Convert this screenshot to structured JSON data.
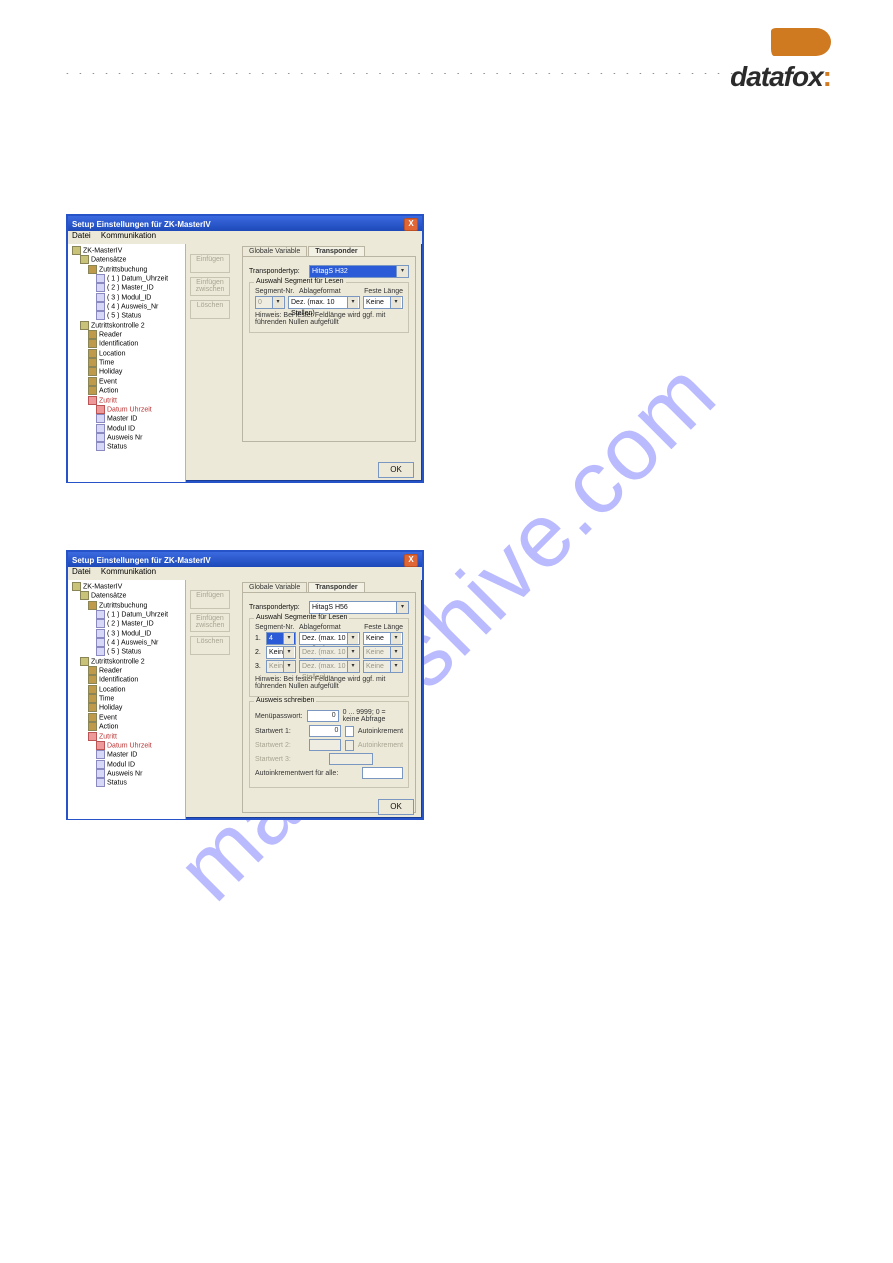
{
  "watermark_text": "manualshive.com",
  "logo_text": "datafox",
  "logo_colon": ":",
  "dots": "• • • • • • • • • • • • • • • • • • • • • • • • • • • • • • • • • • • • • • • • • • • • • • • • • • • • • • • • • • • • • • • • • • • • • • • • • • • • • • • • • • • • • • • • • • • • • • • •",
  "dialog_title": "Setup Einstellungen für ZK-MasterIV",
  "close_label": "X",
  "menu": {
    "datei": "Datei",
    "komm": "Kommunikation"
  },
  "buttons": {
    "einfuegen": "Einfügen",
    "einfuegen_zw": "Einfügen zwischen",
    "loeschen": "Löschen",
    "ok": "OK"
  },
  "tabs": {
    "globale": "Globale Variable",
    "transponder": "Transponder"
  },
  "labels": {
    "transpondertyp": "Transpondertyp:",
    "group_read": "Auswahl Segment für Lesen",
    "group_read_plural": "Auswahl Segmente für Lesen",
    "segment_nr": "Segment-Nr.",
    "ablageformat": "Ablageformat",
    "feste_laenge": "Feste Länge",
    "hint": "Hinweis: Bei fester Feldlänge wird ggf. mit führenden Nullen aufgefüllt",
    "seg_none": "Kein",
    "dec10": "Dez. (max. 10 Stellen)",
    "keine": "Keine",
    "group_write": "Ausweis schreiben",
    "menupw": "Menüpasswort:",
    "menupw_hint": "0 ... 9999; 0 = keine Abfrage",
    "start1": "Startwert 1:",
    "start2": "Startwert 2:",
    "start3": "Startwert 3:",
    "autoinc": "Autoinkrement",
    "autoincall": "Autoinkrementwert für alle:"
  },
  "typeA": "HitagS H32",
  "typeB": "HitagS H56",
  "seg_sel_value": "4",
  "write": {
    "menupw_val": "0",
    "sv1": "0",
    "sv2": "",
    "sv3": ""
  },
  "tree": {
    "root": "ZK-MasterIV",
    "datensaetze": "Datensätze",
    "zutrittsbuchung": "Zutrittsbuchung",
    "f1": "( 1 ) Datum_Uhrzeit",
    "f2": "( 2 ) Master_ID",
    "f3": "( 3 ) Modul_ID",
    "f4": "( 4 ) Ausweis_Nr",
    "f5": "( 5 ) Status",
    "zk2": "Zutrittskontrolle 2",
    "reader": "Reader",
    "identification": "Identification",
    "location": "Location",
    "time": "Time",
    "holiday": "Holiday",
    "event": "Event",
    "action": "Action",
    "zutritt": "Zutritt",
    "du": "Datum Uhrzeit",
    "mid": "Master ID",
    "moid": "Modul ID",
    "awnr": "Ausweis Nr",
    "status": "Status"
  }
}
